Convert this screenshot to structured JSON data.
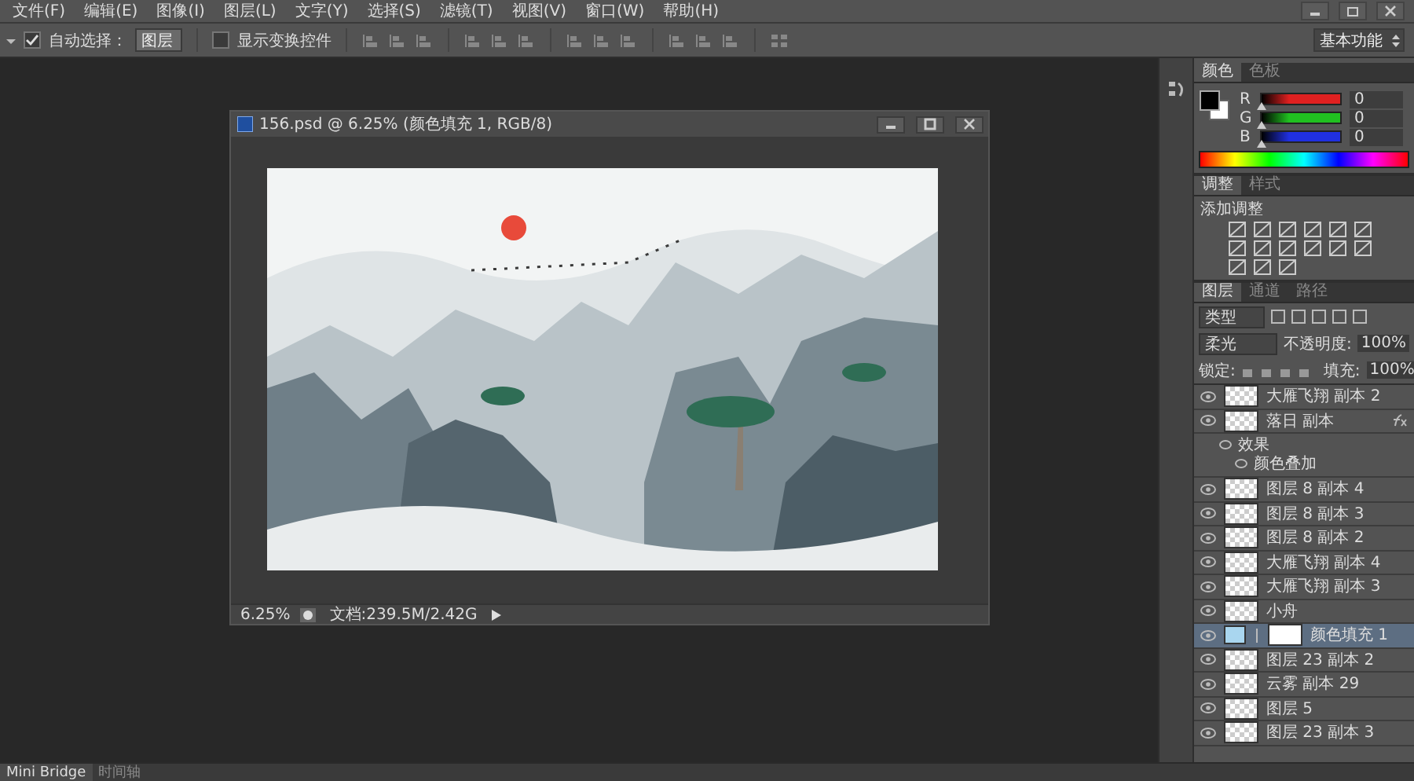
{
  "menu": [
    "文件(F)",
    "编辑(E)",
    "图像(I)",
    "图层(L)",
    "文字(Y)",
    "选择(S)",
    "滤镜(T)",
    "视图(V)",
    "窗口(W)",
    "帮助(H)"
  ],
  "options": {
    "auto_select": {
      "label": "自动选择：",
      "checked": true
    },
    "auto_select_target": "图层",
    "show_transform": {
      "label": "显示变换控件",
      "checked": false
    },
    "workspace": "基本功能"
  },
  "document": {
    "title": "156.psd @ 6.25% (颜色填充 1, RGB/8)",
    "zoom": "6.25%",
    "doc_info": "文档:239.5M/2.42G"
  },
  "color_panel": {
    "tabs": [
      {
        "label": "颜色",
        "selected": true
      },
      {
        "label": "色板",
        "selected": false
      }
    ],
    "channels": [
      {
        "label": "R",
        "value": "0",
        "level": 0,
        "color": "#e02020"
      },
      {
        "label": "G",
        "value": "0",
        "level": 0,
        "color": "#20c020"
      },
      {
        "label": "B",
        "value": "0",
        "level": 0,
        "color": "#2030e0"
      }
    ]
  },
  "adjustments_panel": {
    "tabs": [
      {
        "label": "调整",
        "selected": true
      },
      {
        "label": "样式",
        "selected": false
      }
    ],
    "title": "添加调整"
  },
  "layers_panel": {
    "tabs": [
      {
        "label": "图层",
        "selected": true
      },
      {
        "label": "通道",
        "selected": false
      },
      {
        "label": "路径",
        "selected": false
      }
    ],
    "filter": "类型",
    "blend_mode": "柔光",
    "opacity_label": "不透明度:",
    "opacity": "100%",
    "lock_label": "锁定:",
    "fill_label": "填充:",
    "fill": "100%",
    "layers": [
      {
        "name": "大雁飞翔 副本 2",
        "kind": "layer",
        "visible": true,
        "selected": false
      },
      {
        "name": "落日 副本",
        "kind": "layer",
        "visible": true,
        "selected": false,
        "fx": true,
        "effects": {
          "label": "效果",
          "items": [
            "颜色叠加"
          ]
        }
      },
      {
        "name": "图层 8 副本 4",
        "kind": "layer",
        "visible": true,
        "selected": false
      },
      {
        "name": "图层 8 副本 3",
        "kind": "layer",
        "visible": true,
        "selected": false
      },
      {
        "name": "图层 8 副本 2",
        "kind": "layer",
        "visible": true,
        "selected": false
      },
      {
        "name": "大雁飞翔 副本 4",
        "kind": "layer",
        "visible": true,
        "selected": false
      },
      {
        "name": "大雁飞翔 副本 3",
        "kind": "layer",
        "visible": true,
        "selected": false
      },
      {
        "name": "小舟",
        "kind": "layer",
        "visible": true,
        "selected": false
      },
      {
        "name": "颜色填充 1",
        "kind": "fill",
        "visible": true,
        "selected": true
      },
      {
        "name": "图层 23 副本 2",
        "kind": "layer",
        "visible": true,
        "selected": false
      },
      {
        "name": "云雾 副本 29",
        "kind": "layer",
        "visible": true,
        "selected": false
      },
      {
        "name": "图层 5",
        "kind": "layer",
        "visible": true,
        "selected": false
      },
      {
        "name": "图层 23 副本 3",
        "kind": "layer",
        "visible": true,
        "selected": false
      }
    ]
  },
  "bottom_tabs": [
    {
      "label": "Mini Bridge",
      "selected": true
    },
    {
      "label": "时间轴",
      "selected": false
    }
  ]
}
